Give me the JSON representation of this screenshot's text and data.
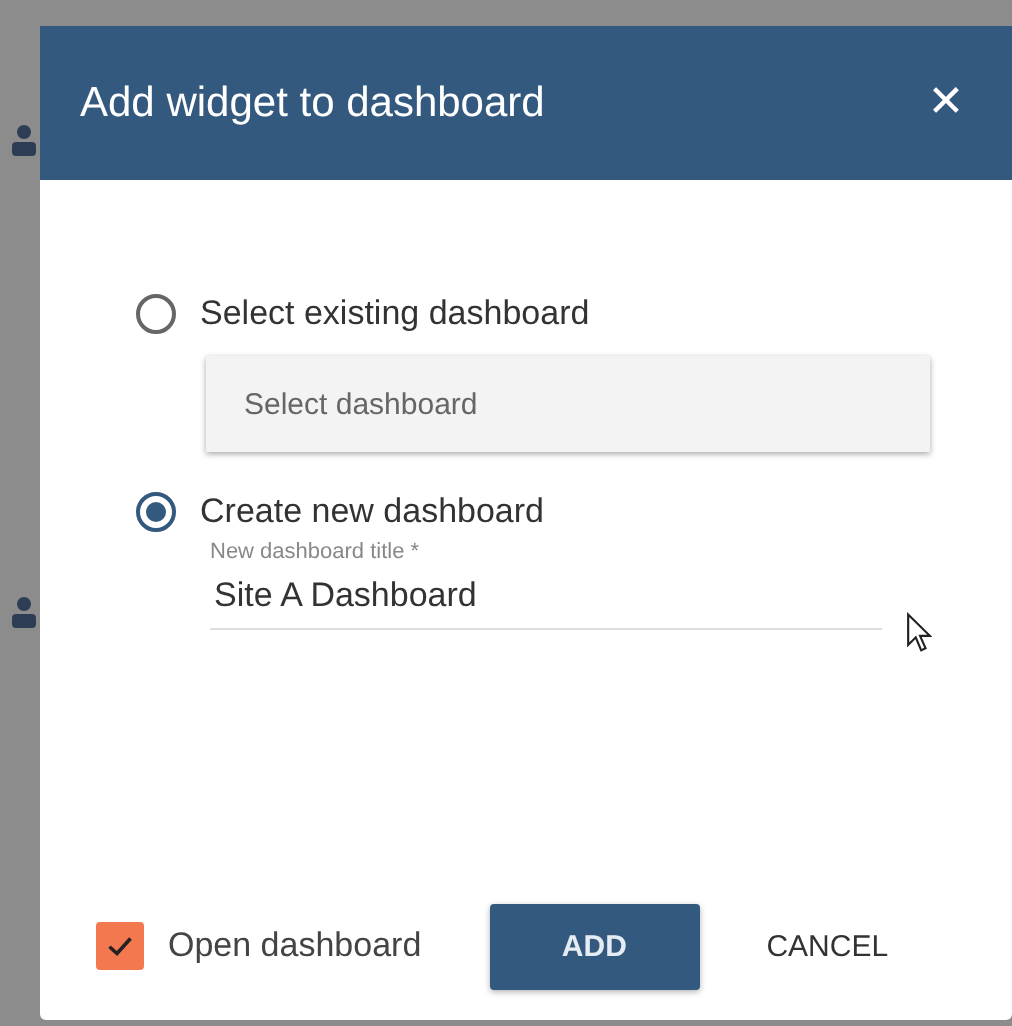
{
  "dialog": {
    "title": "Add widget to dashboard",
    "close": "✕",
    "options": [
      {
        "label": "Select existing dashboard",
        "selected": false,
        "kind": "select",
        "placeholder": "Select dashboard"
      },
      {
        "label": "Create new dashboard",
        "selected": true,
        "kind": "text",
        "field_label": "New dashboard title *",
        "value": "Site A Dashboard"
      }
    ],
    "open_dashboard": {
      "label": "Open dashboard",
      "checked": true
    },
    "buttons": [
      {
        "label": "ADD",
        "kind": "primary"
      },
      {
        "label": "CANCEL",
        "kind": "flat"
      }
    ]
  }
}
